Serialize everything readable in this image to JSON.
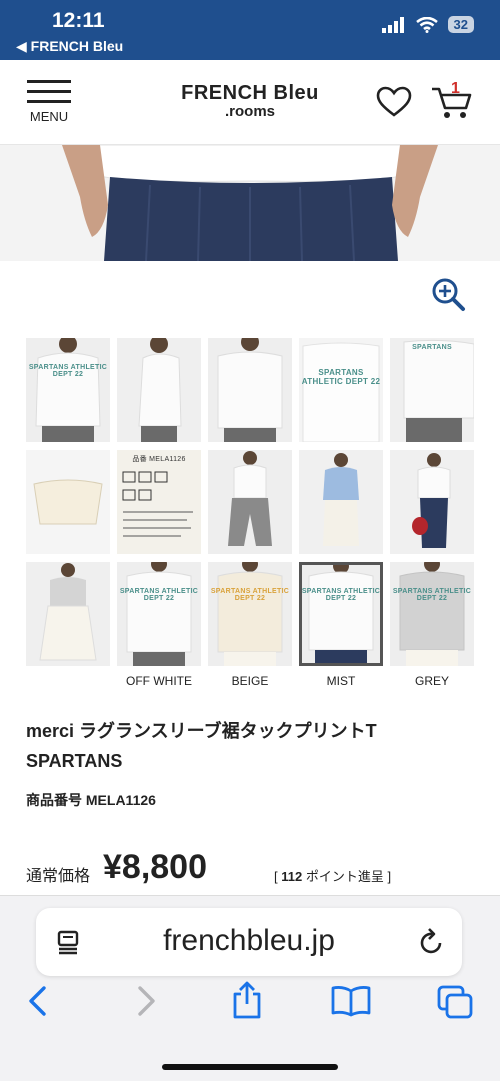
{
  "status_bar": {
    "time": "12:11",
    "back_label": "◀ FRENCH Bleu",
    "battery": "32",
    "icons": [
      "signal-icon",
      "wifi-icon",
      "battery-icon"
    ]
  },
  "header": {
    "menu_label": "MENU",
    "logo_line1": "FRENCH Bleu",
    "logo_line2": ".rooms",
    "cart_count": "1",
    "icons": [
      "hamburger-icon",
      "heart-icon",
      "cart-icon"
    ]
  },
  "gallery": {
    "zoom_icon": "zoom-in-icon",
    "thumbnails": [
      {
        "caption": "SPARTANS ATHLETIC DEPT 22"
      },
      {
        "caption": ""
      },
      {
        "caption": ""
      },
      {
        "caption": "SPARTANS ATHLETIC DEPT 22"
      },
      {
        "caption": "SPARTANS"
      },
      {
        "caption": ""
      },
      {
        "caption": "品番 MELA1126"
      },
      {
        "caption": ""
      },
      {
        "caption": ""
      },
      {
        "caption": ""
      },
      {
        "caption": ""
      },
      {
        "caption": "SPARTANS ATHLETIC DEPT 22"
      },
      {
        "caption": "SPARTANS ATHLETIC DEPT 22"
      },
      {
        "caption": "SPARTANS ATHLETIC DEPT 22"
      },
      {
        "caption": "SPARTANS ATHLETIC DEPT 22"
      }
    ],
    "color_labels": [
      "OFF WHITE",
      "BEIGE",
      "MIST",
      "GREY"
    ],
    "selected_color": "MIST"
  },
  "product": {
    "title": "merci ラグランスリーブ裾タックプリントT SPARTANS",
    "sku": "商品番号 MELA1126",
    "price_label": "通常価格",
    "price": "¥8,800",
    "points_open": "[ ",
    "points_value": "112",
    "points_text": " ポイント進呈 ]"
  },
  "safari": {
    "url": "frenchbleu.jp",
    "icons": [
      "tab-overview-icon",
      "reload-icon",
      "back-icon",
      "forward-icon",
      "share-icon",
      "bookmarks-icon",
      "tabs-icon"
    ]
  },
  "colors": {
    "status_bar_bg": "#1f4f8e",
    "accent_teal": "#4a8f8a",
    "cart_badge": "#d0302b",
    "ios_blue": "#1a73e8"
  }
}
